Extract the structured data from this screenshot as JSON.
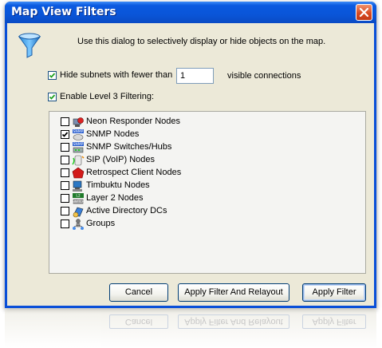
{
  "window": {
    "title": "Map View Filters"
  },
  "instructions": "Use this dialog to selectively display or hide objects on the map.",
  "hide_subnets": {
    "checked": true,
    "label": "Hide subnets with fewer than",
    "value": "1",
    "suffix": "visible connections"
  },
  "level3": {
    "checked": true,
    "label": "Enable Level 3 Filtering:"
  },
  "filters": [
    {
      "label": "Neon Responder Nodes",
      "checked": false,
      "icon": "neon-responder-icon"
    },
    {
      "label": "SNMP Nodes",
      "checked": true,
      "icon": "snmp-icon"
    },
    {
      "label": "SNMP Switches/Hubs",
      "checked": false,
      "icon": "switch-icon"
    },
    {
      "label": "SIP (VoIP) Nodes",
      "checked": false,
      "icon": "sip-phone-icon"
    },
    {
      "label": "Retrospect Client Nodes",
      "checked": false,
      "icon": "retrospect-icon"
    },
    {
      "label": "Timbuktu Nodes",
      "checked": false,
      "icon": "timbuktu-icon"
    },
    {
      "label": "Layer 2 Nodes",
      "checked": false,
      "icon": "layer2-icon"
    },
    {
      "label": "Active Directory DCs",
      "checked": false,
      "icon": "active-directory-icon"
    },
    {
      "label": "Groups",
      "checked": false,
      "icon": "groups-icon"
    }
  ],
  "buttons": {
    "cancel": "Cancel",
    "apply_relayout": "Apply Filter And Relayout",
    "apply": "Apply Filter"
  },
  "colors": {
    "title_bar": "#0a55d8",
    "dialog_bg": "#ece9d8",
    "close_button": "#d84a21"
  }
}
